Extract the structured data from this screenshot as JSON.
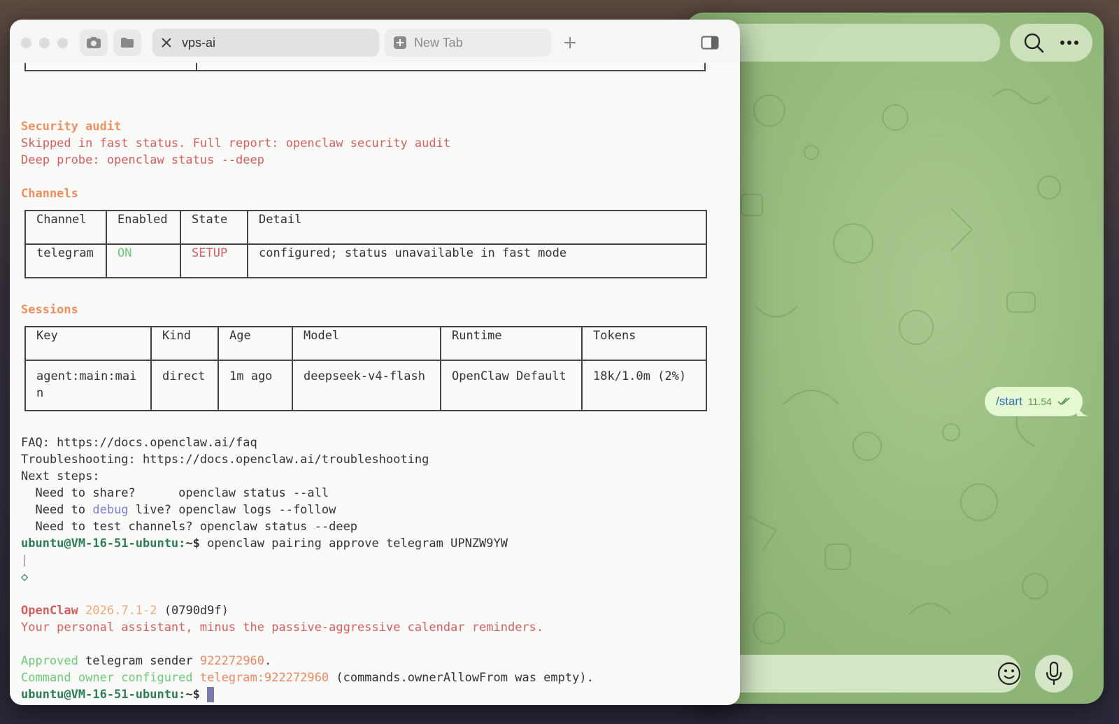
{
  "terminal": {
    "tabs": [
      {
        "title": "vps-ai",
        "active": true
      },
      {
        "title": "New Tab",
        "active": false
      }
    ],
    "security_audit": {
      "heading": "Security audit",
      "line1": "Skipped in fast status. Full report: openclaw security audit",
      "line2": "Deep probe: openclaw status --deep"
    },
    "channels": {
      "heading": "Channels",
      "headers": [
        "Channel",
        "Enabled",
        "State",
        "Detail"
      ],
      "row": {
        "channel": "telegram",
        "enabled": "ON",
        "state": "SETUP",
        "detail": "configured; status unavailable in fast mode"
      }
    },
    "sessions": {
      "heading": "Sessions",
      "headers": [
        "Key",
        "Kind",
        "Age",
        "Model",
        "Runtime",
        "Tokens"
      ],
      "row": {
        "key_line1": "agent:main:mai",
        "key_line2": "n",
        "kind": "direct",
        "age": "1m ago",
        "model": "deepseek-v4-flash",
        "runtime": "OpenClaw Default",
        "tokens": "18k/1.0m (2%)"
      }
    },
    "faq": "FAQ: https://docs.openclaw.ai/faq",
    "troubleshooting": "Troubleshooting: https://docs.openclaw.ai/troubleshooting",
    "next_steps": "Next steps:",
    "step1": "  Need to share?      openclaw status --all",
    "step2_pre": "  Need to ",
    "step2_word": "debug",
    "step2_post": " live? openclaw logs --follow",
    "step3": "  Need to test channels? openclaw status --deep",
    "prompt": "ubuntu@VM-16-51-ubuntu:",
    "prompt_suffix": "~$",
    "command": " openclaw pairing approve telegram UPNZW9YW",
    "bar_glyph": "|",
    "diamond_glyph": "◇",
    "brand": "OpenClaw",
    "version": "2026.7.1-2",
    "commit": "(0790d9f)",
    "tagline": "Your personal assistant, minus the passive-aggressive calendar reminders.",
    "approved_word": "Approved",
    "approved_channel": " telegram ",
    "approved_sender_label": "sender ",
    "approved_sender_id": "922272960",
    "approved_end": ".",
    "owner_text": "Command owner configured",
    "owner_target": "telegram:922272960",
    "owner_note": " (commands.ownerAllowFrom was empty)."
  },
  "telegram": {
    "message_text": "/start",
    "message_time": "11.54"
  },
  "icons": [
    "screenshot-icon",
    "folder-icon",
    "close-icon",
    "new-tab-icon",
    "plus-icon",
    "sidebar-icon",
    "search-icon",
    "more-icon",
    "emoji-icon",
    "mic-icon",
    "double-check-icon"
  ],
  "colors": {
    "heading": "#ee8f5e",
    "on": "#6fc97a",
    "setup": "#d0605e",
    "prompt": "#2f7d55",
    "link_word": "#7a7fd8"
  }
}
